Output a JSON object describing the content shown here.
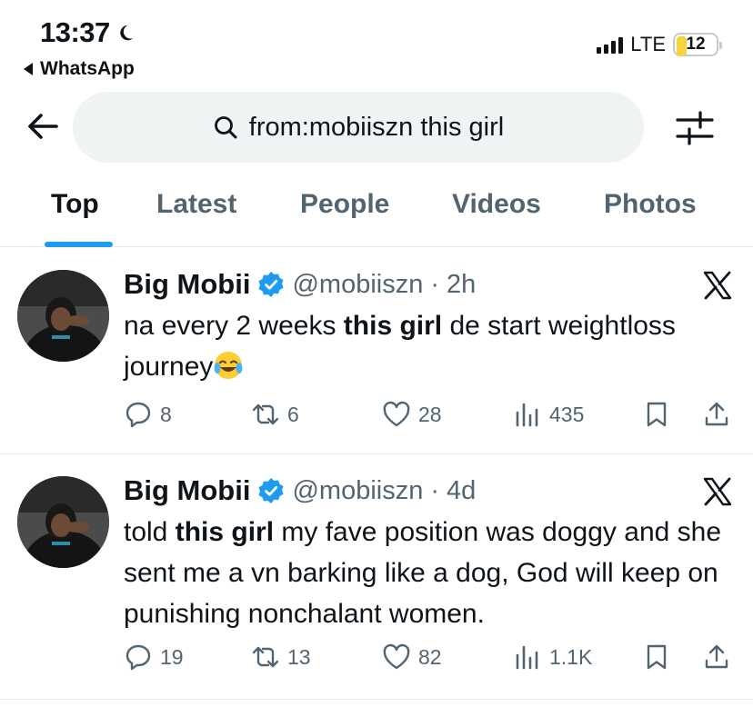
{
  "status_bar": {
    "time": "13:37",
    "back_app": "WhatsApp",
    "network": "LTE",
    "battery": "12"
  },
  "search": {
    "query": "from:mobiiszn this girl"
  },
  "tabs": [
    {
      "label": "Top",
      "active": true
    },
    {
      "label": "Latest",
      "active": false
    },
    {
      "label": "People",
      "active": false
    },
    {
      "label": "Videos",
      "active": false
    },
    {
      "label": "Photos",
      "active": false
    }
  ],
  "tweets": [
    {
      "name": "Big Mobii",
      "handle": "@mobiiszn",
      "dot": "·",
      "time": "2h",
      "text_parts": [
        "na every 2 weeks ",
        "this girl",
        " de start weightloss journey"
      ],
      "emoji": "face-with-tears-of-joy",
      "replies": "8",
      "reposts": "6",
      "likes": "28",
      "views": "435"
    },
    {
      "name": "Big Mobii",
      "handle": "@mobiiszn",
      "dot": "·",
      "time": "4d",
      "text_parts": [
        "told ",
        "this girl",
        " my fave position was doggy and she sent me a vn barking like a dog, God will keep on punishing nonchalant women."
      ],
      "replies": "19",
      "reposts": "13",
      "likes": "82",
      "views": "1.1K"
    }
  ],
  "colors": {
    "accent": "#1d9bf0",
    "muted": "#536471",
    "text": "#0f1419",
    "search_bg": "#eff3f4",
    "battery": "#f5d442"
  }
}
